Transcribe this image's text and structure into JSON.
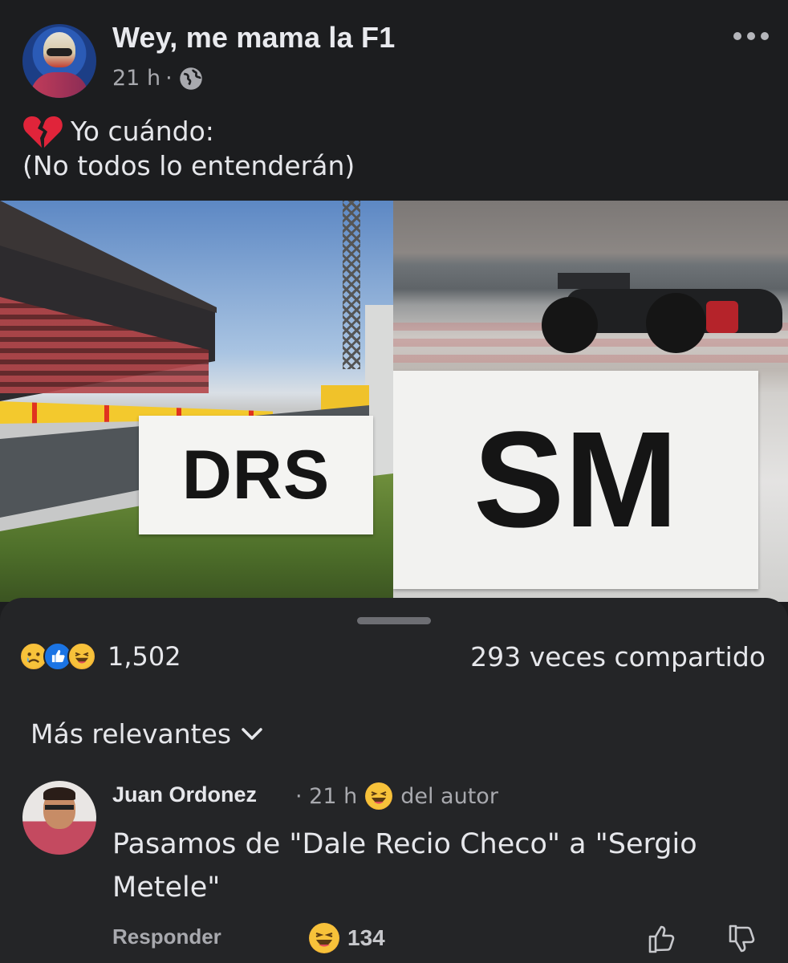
{
  "post": {
    "page_name": "Wey, me mama la F1",
    "time": "21 h",
    "dot": "·",
    "text_line1": "Yo cuándo:",
    "text_line2": "(No todos lo entenderán)"
  },
  "meme": {
    "left_sign": "DRS",
    "right_sign": "SM"
  },
  "engagement": {
    "reaction_count": "1,502",
    "shares": "293 veces compartido"
  },
  "comments": {
    "sort_label": "Más relevantes",
    "items": [
      {
        "author": "Juan Ordonez",
        "time": "· 21 h",
        "badge": "del autor",
        "text": "Pasamos de \"Dale Recio Checo\" a \"Sergio Metele\"",
        "reply_label": "Responder",
        "reaction_count": "134"
      }
    ]
  },
  "colors": {
    "background": "#1c1d1f",
    "sheet": "#242527",
    "accent_like": "#1b74e4"
  }
}
